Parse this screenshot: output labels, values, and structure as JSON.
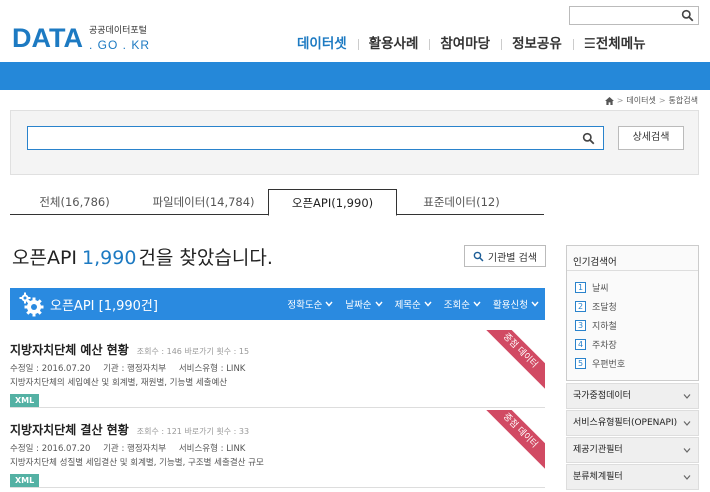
{
  "header": {
    "top_search_placeholder": "",
    "logo_main": "DATA",
    "logo_ko": "공공데이터포털",
    "logo_en": ". GO . KR",
    "nav": [
      "데이터셋",
      "활용사례",
      "참여마당",
      "정보공유",
      "☰전체메뉴"
    ],
    "active_nav": 0
  },
  "breadcrumb": [
    "데이터셋",
    "통합검색"
  ],
  "search": {
    "value": "",
    "detail_button": "상세검색"
  },
  "tabs": [
    {
      "label": "전체(16,786)"
    },
    {
      "label": "파일데이터(14,784)"
    },
    {
      "label": "오픈API(1,990)"
    },
    {
      "label": "표준데이터(12)"
    }
  ],
  "active_tab": 2,
  "result": {
    "prefix": "오픈API",
    "count": "1,990",
    "suffix": "건을 찾았습니다.",
    "agency_button": "기관별 검색"
  },
  "result_bar": {
    "title": "오픈API [1,990건]",
    "sorts": [
      "정확도순",
      "날짜순",
      "제목순",
      "조회순",
      "활용신청"
    ]
  },
  "items": [
    {
      "title": "지방자치단체 예산 현황",
      "stats": "조회수 : 146    바로가기 횟수 : 15",
      "modified": "수정일 : 2016.07.20",
      "org": "기관 : 행정자치부",
      "service": "서비스유형 : LINK",
      "desc": "지방자치단체의 세입예산 및 회계별, 재원별, 기능별 세출예산",
      "badge": "XML",
      "ribbon": "중점 데이터"
    },
    {
      "title": "지방자치단체 결산 현황",
      "stats": "조회수 : 121    바로가기 횟수 : 33",
      "modified": "수정일 : 2016.07.20",
      "org": "기관 : 행정자치부",
      "service": "서비스유형 : LINK",
      "desc": "지방자치단체 성질별 세입결산 및 회계별, 기능별, 구조별 세출결산 규모",
      "badge": "XML",
      "ribbon": "중점 데이터"
    }
  ],
  "popular": {
    "title": "인기검색어",
    "keywords": [
      {
        "rank": "1",
        "word": "날씨"
      },
      {
        "rank": "2",
        "word": "조달청"
      },
      {
        "rank": "3",
        "word": "지하철"
      },
      {
        "rank": "4",
        "word": "주차장"
      },
      {
        "rank": "5",
        "word": "우편번호"
      }
    ]
  },
  "filters": [
    "국가중점데이터",
    "서비스유형필터(OPENAPI)",
    "제공기관필터",
    "분류체계필터"
  ],
  "colors": {
    "brand": "#1d7ac2",
    "band": "#2588d9",
    "bar": "#2a8ae0",
    "ribbon": "#d14a63",
    "xml": "#54b1a4"
  }
}
